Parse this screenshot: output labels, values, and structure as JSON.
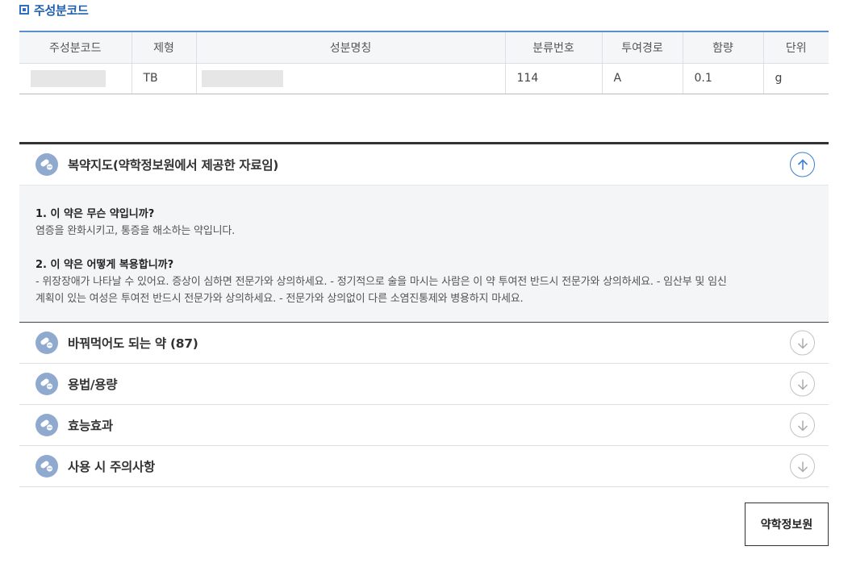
{
  "section": {
    "title": "주성분코드"
  },
  "table": {
    "headers": [
      "주성분코드",
      "제형",
      "성분명칭",
      "분류번호",
      "투여경로",
      "함량",
      "단위"
    ],
    "row": {
      "code": "",
      "form": "TB",
      "name": "",
      "class_no": "114",
      "route": "A",
      "amount": "0.1",
      "unit": "g"
    }
  },
  "accordion": {
    "guide": {
      "title": "복약지도(약학정보원에서 제공한 자료임)",
      "q1": "1. 이 약은 무슨 약입니까?",
      "a1": "염증을 완화시키고, 통증을 해소하는 약입니다.",
      "q2": "2. 이 약은 어떻게 복용합니까?",
      "a2_line1": "- 위장장애가 나타날 수 있어요. 증상이 심하면 전문가와 상의하세요. - 정기적으로 술을 마시는 사람은 이 약 투여전 반드시 전문가와 상의하세요. - 임산부 및 임신",
      "a2_line2": "계획이 있는 여성은 투여전 반드시 전문가와 상의하세요. - 전문가와 상의없이 다른 소염진통제와 병용하지 마세요."
    },
    "items": [
      {
        "title": "바꿔먹어도 되는 약 (87)"
      },
      {
        "title": "용법/용량"
      },
      {
        "title": "효능효과"
      },
      {
        "title": "사용 시 주의사항"
      }
    ]
  },
  "source_button": {
    "label": "약학정보원"
  },
  "colors": {
    "accent": "#2f6fbf",
    "icon_bg": "#8fa9cf",
    "open_arrow": "#3d7fd0"
  }
}
